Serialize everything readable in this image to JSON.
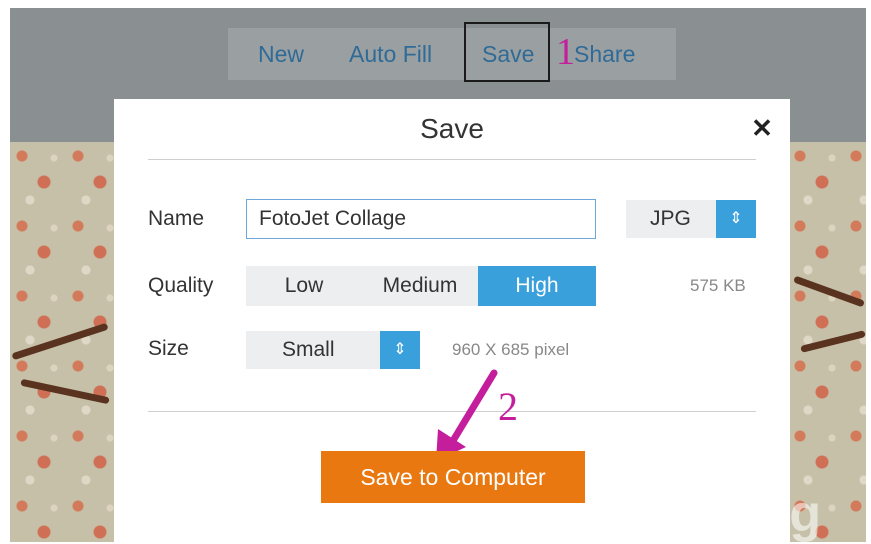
{
  "toolbar": {
    "new_label": "New",
    "autofill_label": "Auto Fill",
    "save_label": "Save",
    "share_label": "Share",
    "annotation": "1"
  },
  "dialog": {
    "title": "Save",
    "close_icon": "close-icon",
    "name_label": "Name",
    "name_value": "FotoJet Collage",
    "format": {
      "value": "JPG",
      "icon": "updown-chevron-icon"
    },
    "quality_label": "Quality",
    "quality_options": [
      "Low",
      "Medium",
      "High"
    ],
    "quality_selected": "High",
    "file_size": "575 KB",
    "size_label": "Size",
    "size": {
      "value": "Small",
      "icon": "updown-chevron-icon"
    },
    "dimensions": "960 X 685 pixel",
    "save_button_label": "Save to Computer",
    "annotation": "2"
  },
  "colors": {
    "accent_blue": "#39a0dc",
    "primary_orange": "#e8780f",
    "annotation_magenta": "#c41e9c",
    "link_blue": "#2f6b96"
  },
  "watermark": "uantrimang"
}
